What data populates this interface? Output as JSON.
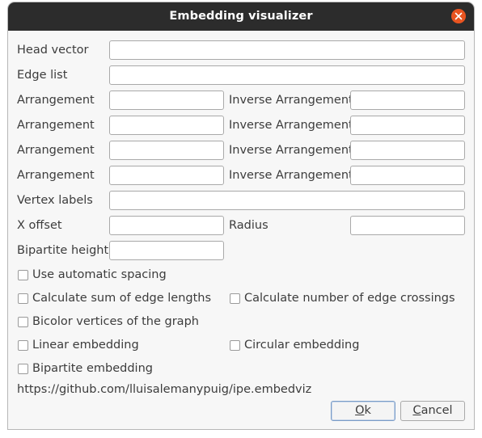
{
  "window": {
    "title": "Embedding visualizer",
    "close_icon": "close-icon"
  },
  "fields": {
    "head_vector_label": "Head vector",
    "head_vector_value": "",
    "edge_list_label": "Edge list",
    "edge_list_value": "",
    "arrangements": [
      {
        "label": "Arrangement",
        "value": "",
        "inverse_label": "Inverse Arrangement",
        "inverse_value": ""
      },
      {
        "label": "Arrangement",
        "value": "",
        "inverse_label": "Inverse Arrangement",
        "inverse_value": ""
      },
      {
        "label": "Arrangement",
        "value": "",
        "inverse_label": "Inverse Arrangement",
        "inverse_value": ""
      },
      {
        "label": "Arrangement",
        "value": "",
        "inverse_label": "Inverse Arrangement",
        "inverse_value": ""
      }
    ],
    "vertex_labels_label": "Vertex labels",
    "vertex_labels_value": "",
    "x_offset_label": "X offset",
    "x_offset_value": "",
    "radius_label": "Radius",
    "radius_value": "",
    "bipartite_height_label": "Bipartite height",
    "bipartite_height_value": ""
  },
  "options": {
    "automatic_spacing": {
      "label": "Use automatic spacing",
      "checked": false
    },
    "sum_edge_lengths": {
      "label": "Calculate sum of edge lengths",
      "checked": false
    },
    "edge_crossings": {
      "label": "Calculate number of edge crossings",
      "checked": false
    },
    "bicolor": {
      "label": "Bicolor vertices of the graph",
      "checked": false
    },
    "linear": {
      "label": "Linear embedding",
      "checked": false
    },
    "circular": {
      "label": "Circular embedding",
      "checked": false
    },
    "bipartite": {
      "label": "Bipartite embedding",
      "checked": false
    }
  },
  "footer": {
    "url_text": "https://github.com/lluisalemanypuig/ipe.embedviz",
    "ok_mnemonic": "O",
    "ok_rest": "k",
    "cancel_mnemonic": "C",
    "cancel_rest": "ancel"
  },
  "colors": {
    "titlebar": "#2c2c2c",
    "close_button": "#e95420",
    "dialog_background": "#f7f7f7"
  }
}
